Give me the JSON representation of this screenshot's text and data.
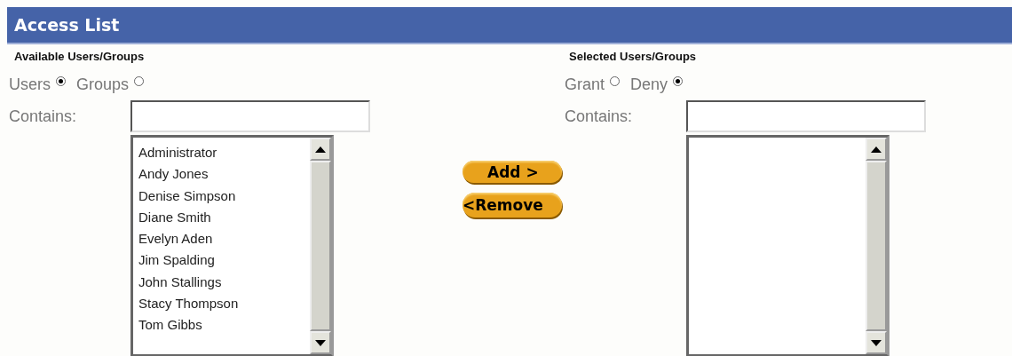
{
  "header": {
    "title": "Access List"
  },
  "available": {
    "heading": "Available Users/Groups",
    "radios": [
      {
        "label": "Users",
        "selected": true
      },
      {
        "label": "Groups",
        "selected": false
      }
    ],
    "contains_label": "Contains:",
    "list": [
      "Administrator",
      "Andy Jones",
      "Denise Simpson",
      "Diane Smith",
      "Evelyn Aden",
      "Jim Spalding",
      "John Stallings",
      "Stacy Thompson",
      "Tom Gibbs"
    ]
  },
  "buttons": [
    "Add >",
    "<Remove"
  ],
  "selected": {
    "heading": "Selected Users/Groups",
    "radios": [
      {
        "label": "Grant",
        "selected": false
      },
      {
        "label": "Deny",
        "selected": true
      }
    ],
    "contains_label": "Contains:"
  }
}
